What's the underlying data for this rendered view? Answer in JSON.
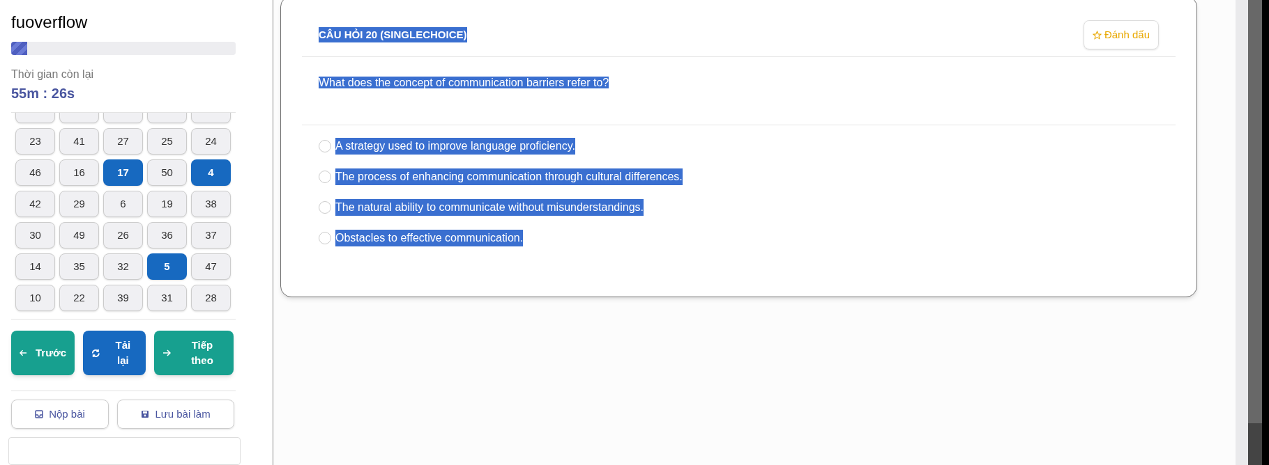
{
  "sidebar": {
    "brand": "fuoverflow",
    "progress": {
      "level": 0.07
    },
    "timer_label": "Thời gian còn lại",
    "timer_value": "55m : 26s",
    "question_grid": [
      {
        "answered": false
      },
      {
        "answered": false
      },
      {
        "answered": false
      },
      {
        "answered": false
      },
      {
        "answered": false
      },
      {
        "label": "23",
        "answered": false
      },
      {
        "label": "41",
        "answered": false
      },
      {
        "label": "27",
        "answered": false
      },
      {
        "label": "25",
        "answered": false
      },
      {
        "label": "24",
        "answered": false
      },
      {
        "label": "46",
        "answered": false
      },
      {
        "label": "16",
        "answered": false
      },
      {
        "label": "17",
        "answered": true
      },
      {
        "label": "50",
        "answered": false
      },
      {
        "label": "4",
        "answered": true
      },
      {
        "label": "42",
        "answered": false
      },
      {
        "label": "29",
        "answered": false
      },
      {
        "label": "6",
        "answered": false
      },
      {
        "label": "19",
        "answered": false
      },
      {
        "label": "38",
        "answered": false
      },
      {
        "label": "30",
        "answered": false
      },
      {
        "label": "49",
        "answered": false
      },
      {
        "label": "26",
        "answered": false
      },
      {
        "label": "36",
        "answered": false
      },
      {
        "label": "37",
        "answered": false
      },
      {
        "label": "14",
        "answered": false
      },
      {
        "label": "35",
        "answered": false
      },
      {
        "label": "32",
        "answered": false
      },
      {
        "label": "5",
        "answered": true
      },
      {
        "label": "47",
        "answered": false
      },
      {
        "label": "10",
        "answered": false
      },
      {
        "label": "22",
        "answered": false
      },
      {
        "label": "39",
        "answered": false
      },
      {
        "label": "31",
        "answered": false
      },
      {
        "label": "28",
        "answered": false
      }
    ],
    "nav_buttons": [
      {
        "kind": "prev",
        "label": "Trước"
      },
      {
        "kind": "reload",
        "label": "Tải lại"
      },
      {
        "kind": "next",
        "label": "Tiếp theo"
      }
    ],
    "action_buttons": [
      {
        "kind": "submit",
        "label": "Nộp bài"
      },
      {
        "kind": "save",
        "label": "Lưu bài làm"
      }
    ]
  },
  "question": {
    "title": "CÂU HỎI 20 (SINGLECHOICE)",
    "bookmark": "Đánh dấu",
    "text": "What does the concept of communication barriers refer to?",
    "options": [
      {
        "text": "A strategy used to improve language proficiency.",
        "selected": false
      },
      {
        "text": "The process of enhancing communication through cultural differences.",
        "selected": false
      },
      {
        "text": "The natural ability to communicate without misunderstandings.",
        "selected": false
      },
      {
        "text": "Obstacles to effective communication.",
        "selected": false
      }
    ]
  }
}
